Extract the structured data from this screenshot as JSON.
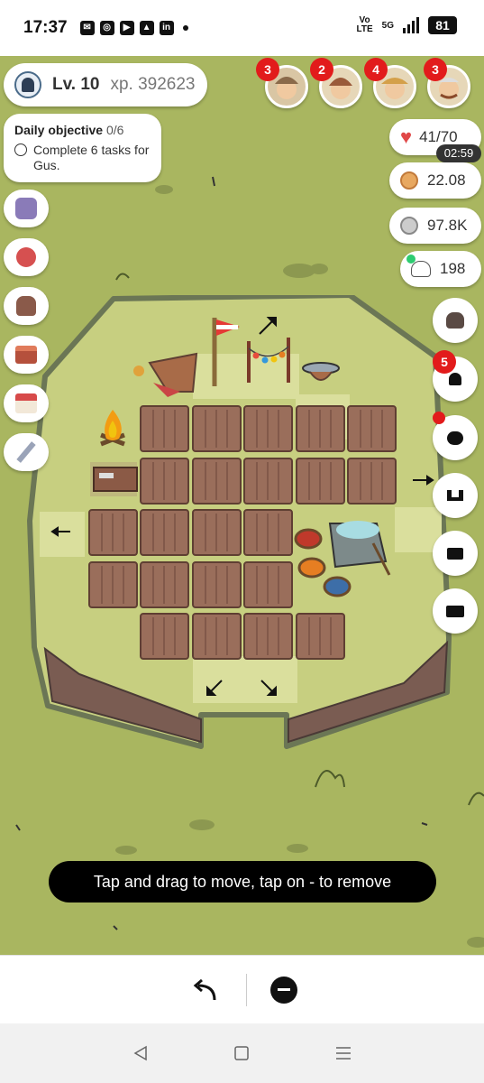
{
  "status_bar": {
    "time": "17:37",
    "volte": [
      "Vo",
      "LTE"
    ],
    "network": "5G",
    "battery": "81"
  },
  "player": {
    "level": "Lv. 10",
    "xp": "xp. 392623"
  },
  "objective": {
    "title": "Daily objective",
    "progress": "0/6",
    "task": "Complete 6 tasks for Gus."
  },
  "customers": [
    {
      "badge": "3"
    },
    {
      "badge": "2"
    },
    {
      "badge": "4"
    },
    {
      "badge": "3"
    }
  ],
  "resources": {
    "hearts": "41/70",
    "heart_timer": "02:59",
    "gold": "22.08",
    "silver": "97.8K",
    "friends": "198"
  },
  "side_buttons": {
    "notification_badge": "5"
  },
  "toast": "Tap and drag to move, tap on - to remove",
  "colors": {
    "grass": "#a9b660",
    "field": "#c7cf80",
    "soil": "#9a6e5b",
    "badge": "#e21b1b"
  }
}
